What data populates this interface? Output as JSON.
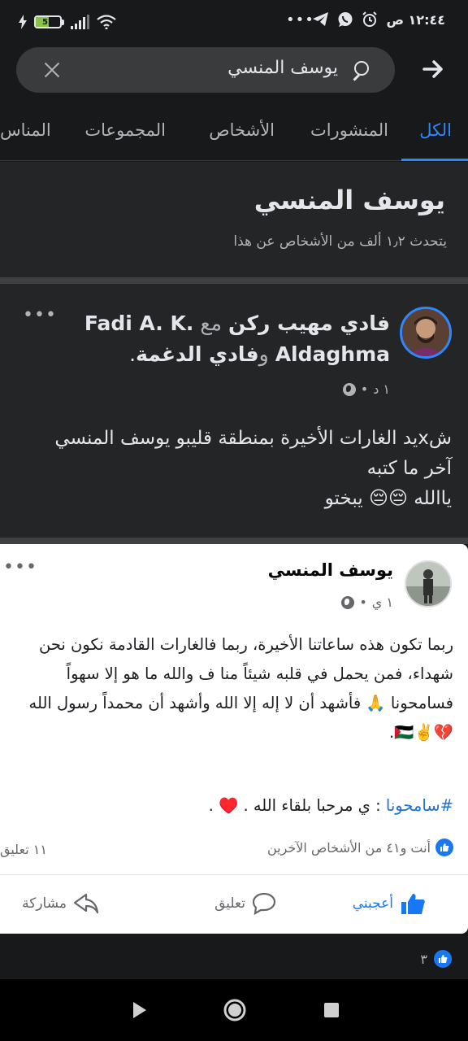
{
  "status_bar": {
    "battery": "52",
    "battery_percent": 52,
    "time": "١٢:٤٤ ص",
    "overflow": "•••",
    "icons": [
      "charging-bolt-icon",
      "battery-icon",
      "signal-icon",
      "wifi-icon",
      "telegram-icon",
      "whatsapp-icon",
      "alarm-icon"
    ]
  },
  "search": {
    "query": "يوسف المنسي"
  },
  "tabs": [
    {
      "label": "الكل",
      "active": true
    },
    {
      "label": "المنشورات",
      "active": false
    },
    {
      "label": "الأشخاص",
      "active": false
    },
    {
      "label": "المجموعات",
      "active": false
    },
    {
      "label": "المناس",
      "active": false
    }
  ],
  "topic": {
    "title": "يوسف المنسي",
    "subtitle": "يتحدث ١٫٢ ألف من الأشخاص عن هذا"
  },
  "post": {
    "author_primary": "فادي مهيب ركن",
    "with_word": "مع",
    "tagged_1": "Fadi A. K. Aldaghma",
    "and_word": "و",
    "tagged_2": "فادي الدغمة",
    "time": "١ د",
    "text_line_1": "شxيد الغارات الأخيرة بمنطقة قليبو يوسف المنسي",
    "text_line_2": "آخر ما كتبه",
    "text_line_3": "ياالله 😔😔 يبختو"
  },
  "shared_post": {
    "author": "يوسف المنسي",
    "time": "١ ي",
    "body": "ربما تكون هذه ساعاتنا الأخيرة، ربما فالغارات القادمة نكون نحن شهداء، فمن يحمل في قلبه شيئاً منا ف والله ما هو إلا سهواً فسامحونا 🙏 فأشهد أن لا إله إلا الله وأشهد أن محمداً رسول الله 💔✌️🇵🇸.",
    "hashtag": "#سامحونا",
    "hashtag_rest": ": ي مرحبا بلقاء الله . ♥️ .",
    "reactions_text": "أنت و٤١ من الأشخاص الآخرين",
    "comments_text": "١١ تعليق",
    "like_label": "أعجبني",
    "comment_label": "تعليق",
    "share_label": "مشاركة"
  },
  "outer_reactions": {
    "count": "٣"
  },
  "navbar": {
    "icons": [
      "back-triangle-icon",
      "home-circle-icon",
      "recents-square-icon"
    ]
  },
  "colors": {
    "background": "#18191a",
    "card": "#242526",
    "accent": "#2d88ff"
  }
}
